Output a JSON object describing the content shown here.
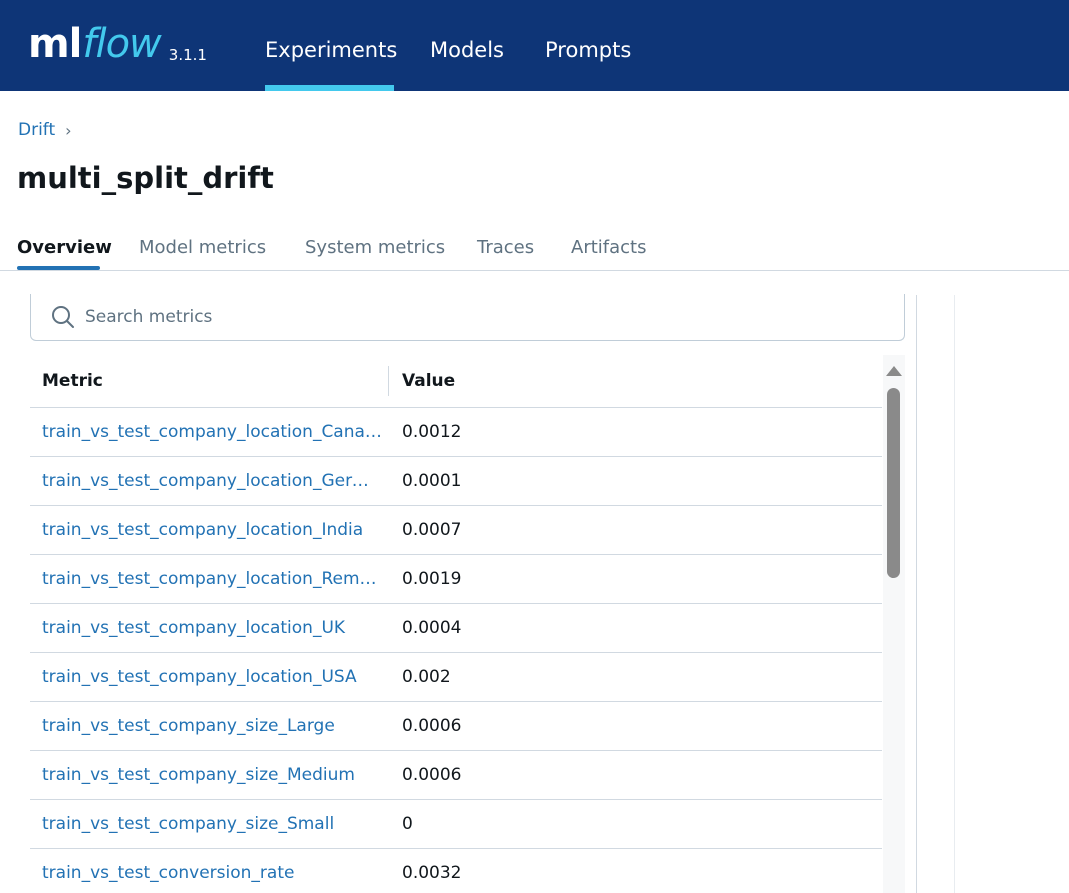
{
  "app": {
    "logo_ml": "ml",
    "logo_flow": "flow",
    "version": "3.1.1",
    "nav": [
      {
        "label": "Experiments",
        "active": true
      },
      {
        "label": "Models",
        "active": false
      },
      {
        "label": "Prompts",
        "active": false
      }
    ]
  },
  "breadcrumb": {
    "parent": "Drift",
    "separator": "›"
  },
  "page": {
    "title": "multi_split_drift"
  },
  "tabs": [
    {
      "label": "Overview",
      "active": true
    },
    {
      "label": "Model metrics",
      "active": false
    },
    {
      "label": "System metrics",
      "active": false
    },
    {
      "label": "Traces",
      "active": false
    },
    {
      "label": "Artifacts",
      "active": false
    }
  ],
  "search": {
    "placeholder": "Search metrics",
    "value": ""
  },
  "table": {
    "columns": [
      "Metric",
      "Value"
    ],
    "rows": [
      {
        "metric": "train_vs_test_company_location_Canada",
        "value": "0.0012"
      },
      {
        "metric": "train_vs_test_company_location_Germany",
        "value": "0.0001"
      },
      {
        "metric": "train_vs_test_company_location_India",
        "value": "0.0007"
      },
      {
        "metric": "train_vs_test_company_location_Remote",
        "value": "0.0019"
      },
      {
        "metric": "train_vs_test_company_location_UK",
        "value": "0.0004"
      },
      {
        "metric": "train_vs_test_company_location_USA",
        "value": "0.002"
      },
      {
        "metric": "train_vs_test_company_size_Large",
        "value": "0.0006"
      },
      {
        "metric": "train_vs_test_company_size_Medium",
        "value": "0.0006"
      },
      {
        "metric": "train_vs_test_company_size_Small",
        "value": "0"
      },
      {
        "metric": "train_vs_test_conversion_rate",
        "value": "0.0032"
      }
    ]
  },
  "colors": {
    "header_bg": "#0e3577",
    "accent": "#43c9ed",
    "link": "#2272b4"
  }
}
